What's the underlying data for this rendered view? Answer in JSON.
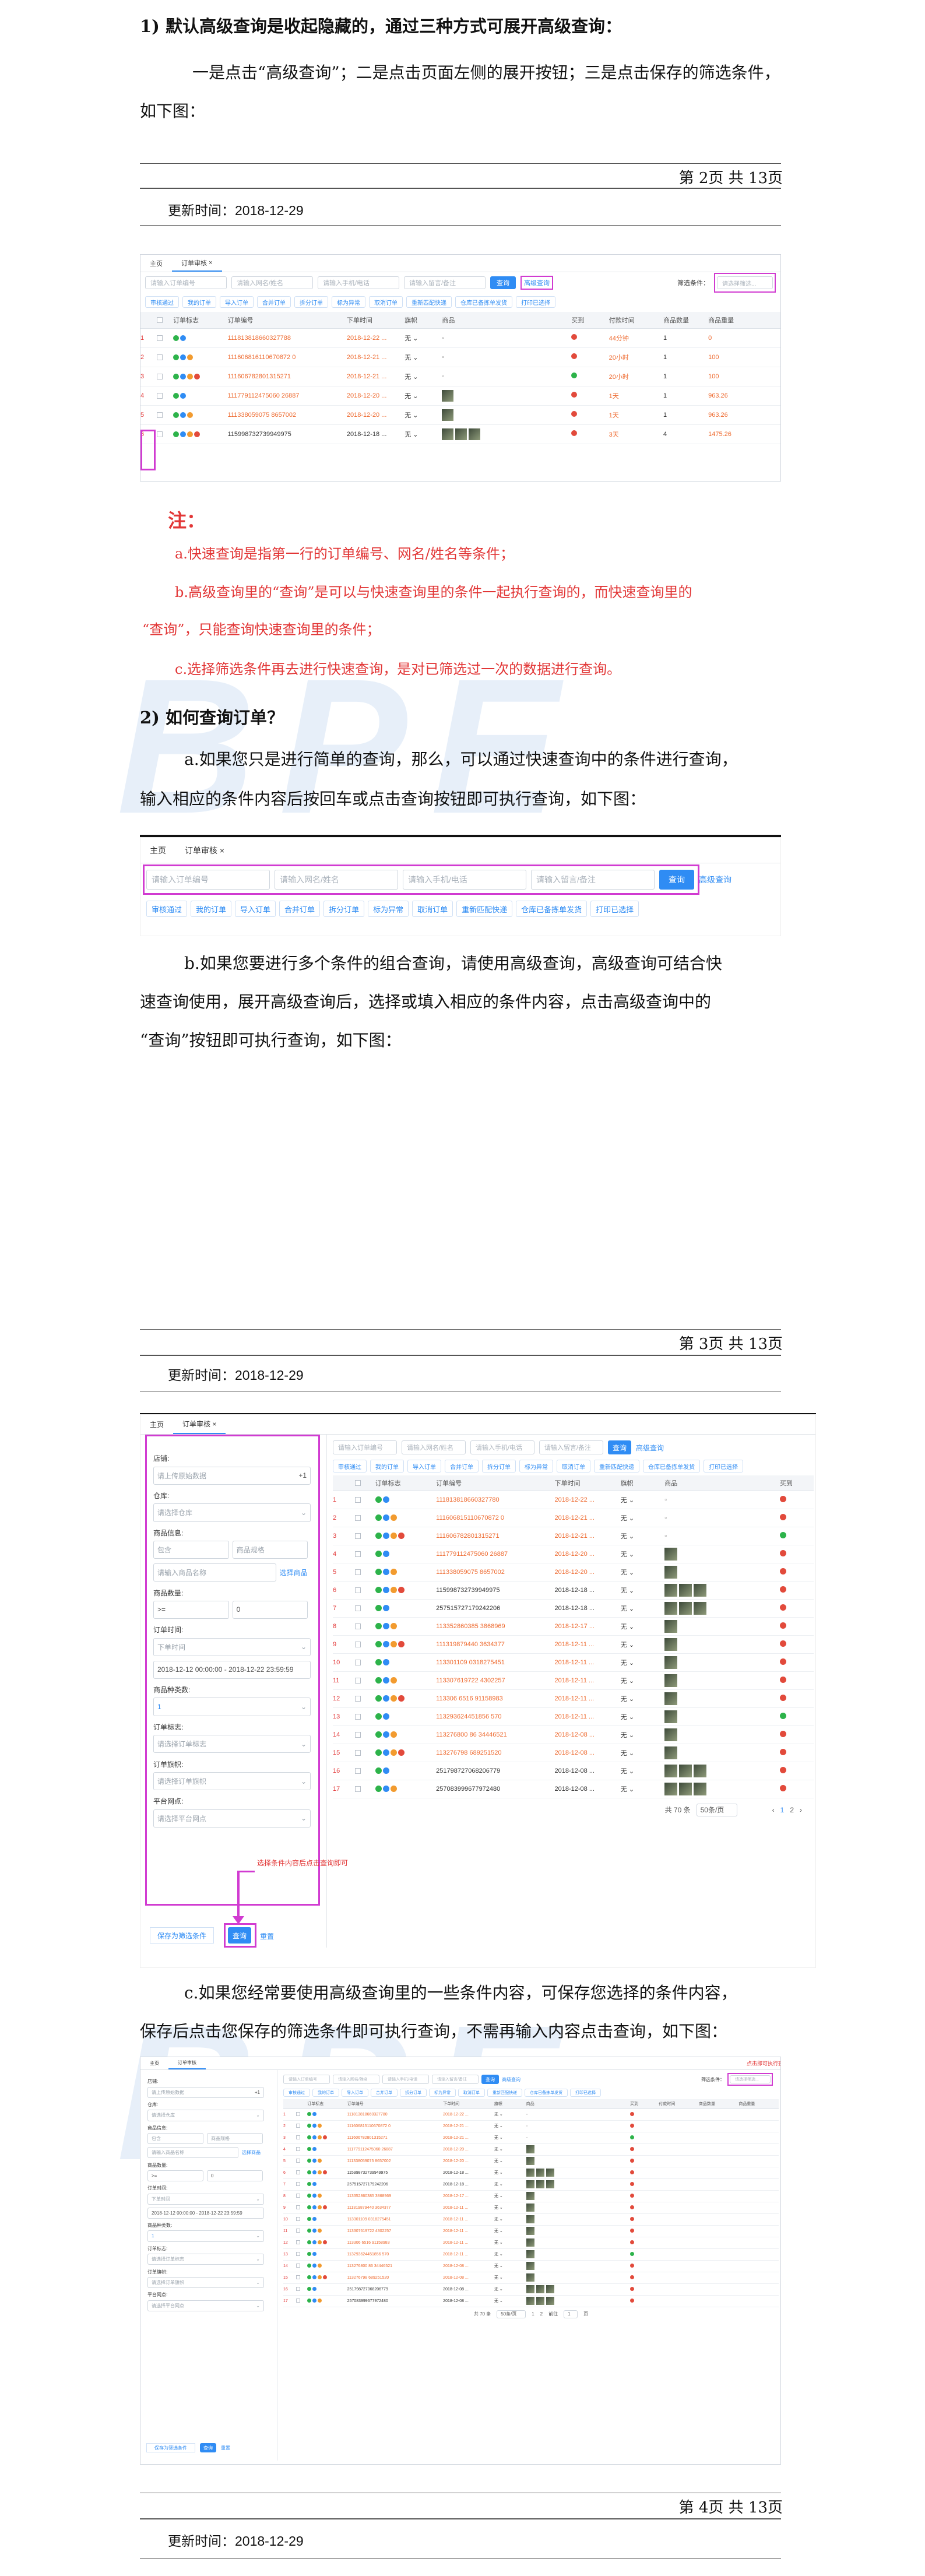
{
  "section1": {
    "heading": "1)  默认高级查询是收起隐藏的，通过三种方式可展开高级查询：",
    "para": "一是点击“高级查询”；二是点击页面左侧的展开按钮；三是点击保存的筛选条件，如下图："
  },
  "footer1": {
    "page": "第 2页  共 13页",
    "updated": "更新时间：2018-12-29"
  },
  "footer2": {
    "page": "第 3页  共 13页",
    "updated": "更新时间：2018-12-29"
  },
  "footer3": {
    "page": "第 4页  共 13页",
    "updated": "更新时间：2018-12-29"
  },
  "note": {
    "title": "注：",
    "a": "a.快速查询是指第一行的订单编号、网名/姓名等条件；",
    "b1": "b.高级查询里的“查询”是可以与快速查询里的条件一起执行查询的，而快速查询里的",
    "b2": "“查询”，只能查询快速查询里的条件；",
    "c": "c.选择筛选条件再去进行快速查询，是对已筛选过一次的数据进行查询。"
  },
  "section2": {
    "heading": "2)  如何查询订单？",
    "pa1": "a.如果您只是进行简单的查询，那么，可以通过快速查询中的条件进行查询，",
    "pa2": "输入相应的条件内容后按回车或点击查询按钮即可执行查询，如下图：",
    "pb1": "b.如果您要进行多个条件的组合查询，请使用高级查询，高级查询可结合快",
    "pb2": "速查询使用，展开高级查询后，选择或填入相应的条件内容，点击高级查询中的",
    "pb3": "“查询”按钮即可执行查询，如下图：",
    "pc1": "c.如果您经常要使用高级查询里的一些条件内容，可保存您选择的条件内容，",
    "pc2": "保存后点击您保存的筛选条件即可执行查询，不需再输入内容点击查询，如下图："
  },
  "watermark": "BPE",
  "ui": {
    "tab_home": "主页",
    "tab_audit": "订单审核",
    "tab_close": "×",
    "ph_order": "请输入订单编号",
    "ph_name": "请输入网名/姓名",
    "ph_phone": "请输入手机/电话",
    "ph_remark": "请输入留言/备注",
    "btn_query": "查询",
    "adv_query": "高级查询",
    "filter_label": "筛选条件：",
    "filter_ph": "请选择筛选...",
    "save_hint": "点击即可执行查询",
    "tools": [
      "审核通过",
      "我的订单",
      "导入订单",
      "合并订单",
      "拆分订单",
      "标为异常",
      "取消订单",
      "重新匹配快递",
      "仓库已备拣单发货",
      "打印已选择"
    ],
    "cols": [
      "订单标志",
      "订单编号",
      "下单时间",
      "旗帜",
      "商品",
      "买到",
      "付款时间",
      "商品数量",
      "商品重量"
    ],
    "rows": [
      {
        "no": "1",
        "order": "111813818660327788",
        "time": "2018-12-22 ...",
        "flag": "red",
        "paid": "44分钟",
        "qty": "1",
        "weight": "0"
      },
      {
        "no": "2",
        "order": "111606816110670872 0",
        "time": "2018-12-21 ...",
        "flag": "red",
        "paid": "20小时",
        "qty": "1",
        "weight": "100"
      },
      {
        "no": "3",
        "order": "111606782801315271",
        "time": "2018-12-21 ...",
        "flag": "ok",
        "paid": "20小时",
        "qty": "1",
        "weight": "100"
      },
      {
        "no": "4",
        "order": "111779112475060 26887",
        "time": "2018-12-20 ...",
        "flag": "red",
        "paid": "1天",
        "qty": "1",
        "weight": "963.26"
      },
      {
        "no": "5",
        "order": "111338059075 8657002",
        "time": "2018-12-20 ...",
        "flag": "red",
        "paid": "1天",
        "qty": "1",
        "weight": "963.26"
      },
      {
        "no": "6",
        "order": "115998732739949975",
        "time": "2018-12-18 ...",
        "flag": "red",
        "paid": "3天",
        "qty": "4",
        "weight": "1475.26",
        "black": true
      }
    ],
    "rows2": [
      {
        "no": "1",
        "order": "111813818660327780",
        "time": "2018-12-22 ...",
        "flag": "red"
      },
      {
        "no": "2",
        "order": "111606815110670872 0",
        "time": "2018-12-21 ...",
        "flag": "red"
      },
      {
        "no": "3",
        "order": "111606782801315271",
        "time": "2018-12-21 ...",
        "flag": "ok"
      },
      {
        "no": "4",
        "order": "111779112475060 26887",
        "time": "2018-12-20 ...",
        "flag": "red"
      },
      {
        "no": "5",
        "order": "111338059075 8657002",
        "time": "2018-12-20 ...",
        "flag": "red"
      },
      {
        "no": "6",
        "order": "115998732739949975",
        "time": "2018-12-18 ...",
        "flag": "red",
        "black": true
      },
      {
        "no": "7",
        "order": "257515727179242206",
        "time": "2018-12-18 ...",
        "flag": "red",
        "black": true
      },
      {
        "no": "8",
        "order": "113352860385 3868969",
        "time": "2018-12-17 ...",
        "flag": "red"
      },
      {
        "no": "9",
        "order": "111319879440 3634377",
        "time": "2018-12-11 ...",
        "flag": "red"
      },
      {
        "no": "10",
        "order": "113301109 0318275451",
        "time": "2018-12-11 ...",
        "flag": "red"
      },
      {
        "no": "11",
        "order": "113307619722 4302257",
        "time": "2018-12-11 ...",
        "flag": "red"
      },
      {
        "no": "12",
        "order": "113306 6516 91158983",
        "time": "2018-12-11 ...",
        "flag": "red"
      },
      {
        "no": "13",
        "order": "113293624451856 570",
        "time": "2018-12-11 ...",
        "flag": "ok"
      },
      {
        "no": "14",
        "order": "113276800 86 34446521",
        "time": "2018-12-08 ...",
        "flag": "red"
      },
      {
        "no": "15",
        "order": "113276798 689251520",
        "time": "2018-12-08 ...",
        "flag": "red"
      },
      {
        "no": "16",
        "order": "251798727068206779",
        "time": "2018-12-08 ...",
        "flag": "red",
        "black": true
      },
      {
        "no": "17",
        "order": "257083999677972480",
        "time": "2018-12-08 ...",
        "flag": "red",
        "black": true
      }
    ],
    "adv": {
      "shop": "店铺:",
      "shop_val": "请上传原始数据",
      "shop_count": "+1",
      "warehouse": "仓库:",
      "warehouse_val": "请选择仓库",
      "goods": "商品信息:",
      "goods_a": "包含",
      "goods_b": "商品规格",
      "goods_ph": "请输入商品名称",
      "goods_link": "选择商品",
      "qty": "商品数量:",
      "qty_op": ">=",
      "qty_val": "0",
      "otime": "订单时间:",
      "otime_val": "下单时间",
      "range": "2018-12-12 00:00:00 - 2018-12-22 23:59:59",
      "kinds": "商品种类数:",
      "kinds_val": "1",
      "flag": "订单标志:",
      "flag_val": "请选择订单标志",
      "remark": "订单旗帜:",
      "remark_val": "请选择订单旗帜",
      "plat": "平台网点:",
      "plat_val": "请选择平台网点",
      "save_btn": "保存为筛选条件",
      "query_btn": "查询",
      "reset": "重置",
      "hint": "选择条件内容后点击查询即可"
    },
    "pager": {
      "total": "共 70 条",
      "size": "50条/页",
      "p1": "1",
      "p2": "2",
      "goto": "前往",
      "goto_val": "1",
      "unit": "页"
    }
  }
}
